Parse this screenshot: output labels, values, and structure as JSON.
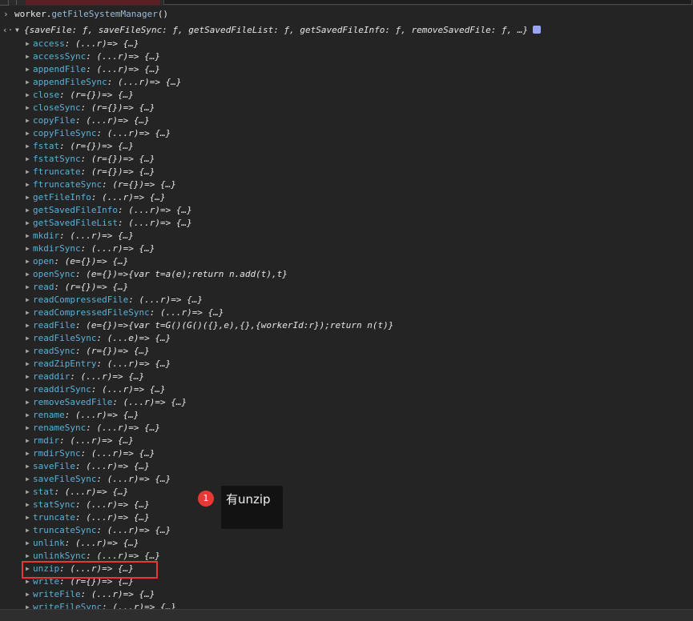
{
  "prompt": {
    "object": "worker.",
    "method": "getFileSystemManager",
    "parens": "()"
  },
  "result": {
    "summary": "{saveFile: ƒ, saveFileSync: ƒ, getSavedFileList: ƒ, getSavedFileInfo: ƒ, removeSavedFile: ƒ, …}"
  },
  "properties": [
    {
      "key": "access",
      "value": "(...r)=> {…}"
    },
    {
      "key": "accessSync",
      "value": "(...r)=> {…}"
    },
    {
      "key": "appendFile",
      "value": "(...r)=> {…}"
    },
    {
      "key": "appendFileSync",
      "value": "(...r)=> {…}"
    },
    {
      "key": "close",
      "value": "(r={})=> {…}"
    },
    {
      "key": "closeSync",
      "value": "(r={})=> {…}"
    },
    {
      "key": "copyFile",
      "value": "(...r)=> {…}"
    },
    {
      "key": "copyFileSync",
      "value": "(...r)=> {…}"
    },
    {
      "key": "fstat",
      "value": "(r={})=> {…}"
    },
    {
      "key": "fstatSync",
      "value": "(r={})=> {…}"
    },
    {
      "key": "ftruncate",
      "value": "(r={})=> {…}"
    },
    {
      "key": "ftruncateSync",
      "value": "(r={})=> {…}"
    },
    {
      "key": "getFileInfo",
      "value": "(...r)=> {…}"
    },
    {
      "key": "getSavedFileInfo",
      "value": "(...r)=> {…}"
    },
    {
      "key": "getSavedFileList",
      "value": "(...r)=> {…}"
    },
    {
      "key": "mkdir",
      "value": "(...r)=> {…}"
    },
    {
      "key": "mkdirSync",
      "value": "(...r)=> {…}"
    },
    {
      "key": "open",
      "value": "(e={})=> {…}"
    },
    {
      "key": "openSync",
      "value": "(e={})=>{var t=a(e);return n.add(t),t}"
    },
    {
      "key": "read",
      "value": "(r={})=> {…}"
    },
    {
      "key": "readCompressedFile",
      "value": "(...r)=> {…}"
    },
    {
      "key": "readCompressedFileSync",
      "value": "(...r)=> {…}"
    },
    {
      "key": "readFile",
      "value": "(e={})=>{var t=G()(G()({},e),{},{workerId:r});return n(t)}"
    },
    {
      "key": "readFileSync",
      "value": "(...e)=> {…}"
    },
    {
      "key": "readSync",
      "value": "(r={})=> {…}"
    },
    {
      "key": "readZipEntry",
      "value": "(...r)=> {…}"
    },
    {
      "key": "readdir",
      "value": "(...r)=> {…}"
    },
    {
      "key": "readdirSync",
      "value": "(...r)=> {…}"
    },
    {
      "key": "removeSavedFile",
      "value": "(...r)=> {…}"
    },
    {
      "key": "rename",
      "value": "(...r)=> {…}"
    },
    {
      "key": "renameSync",
      "value": "(...r)=> {…}"
    },
    {
      "key": "rmdir",
      "value": "(...r)=> {…}"
    },
    {
      "key": "rmdirSync",
      "value": "(...r)=> {…}"
    },
    {
      "key": "saveFile",
      "value": "(...r)=> {…}"
    },
    {
      "key": "saveFileSync",
      "value": "(...r)=> {…}"
    },
    {
      "key": "stat",
      "value": "(...r)=> {…}"
    },
    {
      "key": "statSync",
      "value": "(...r)=> {…}"
    },
    {
      "key": "truncate",
      "value": "(...r)=> {…}"
    },
    {
      "key": "truncateSync",
      "value": "(...r)=> {…}"
    },
    {
      "key": "unlink",
      "value": "(...r)=> {…}"
    },
    {
      "key": "unlinkSync",
      "value": "(...r)=> {…}"
    },
    {
      "key": "unzip",
      "value": "(...r)=> {…}"
    },
    {
      "key": "write",
      "value": "(r={})=> {…}"
    },
    {
      "key": "writeFile",
      "value": "(...r)=> {…}"
    },
    {
      "key": "writeFileSync",
      "value": "(...r)=> {…}"
    }
  ],
  "callout": {
    "number": "1",
    "text": "有unzip"
  },
  "colors": {
    "key": "#5db0d7",
    "highlight": "#e53935",
    "callout_bg": "#121212",
    "badge": "#9aa4f2"
  },
  "icons": {
    "prompt": "chevron-right-icon",
    "result": "return-arrow-icon",
    "expand": "triangle-right-icon",
    "collapse": "triangle-down-icon",
    "info": "info-badge-icon"
  }
}
